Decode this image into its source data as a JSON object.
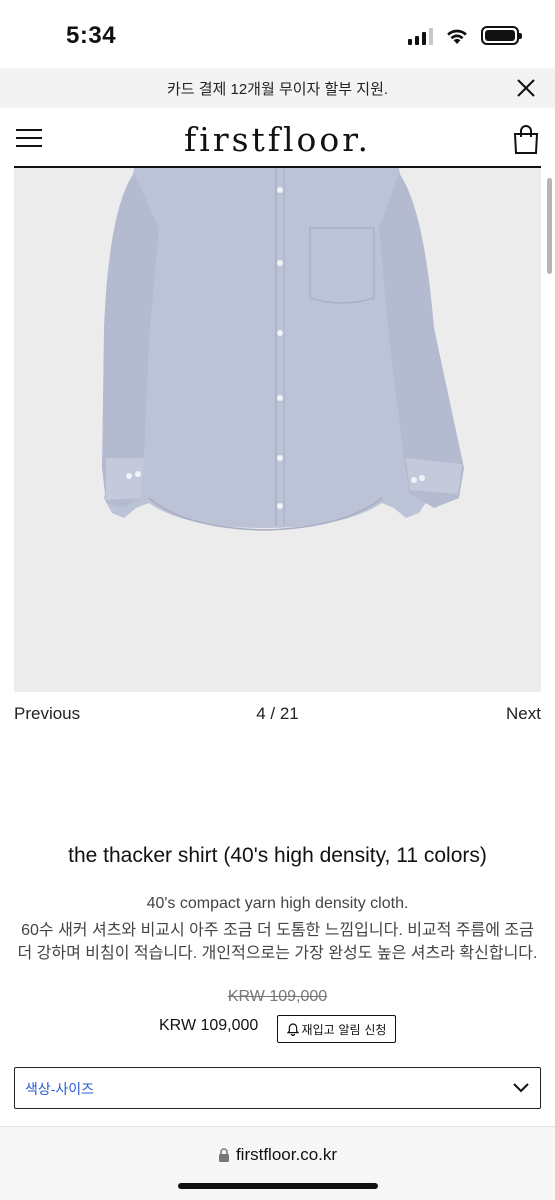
{
  "status_bar": {
    "time": "5:34",
    "icons": [
      "cellular-signal-icon",
      "wifi-icon",
      "battery-icon"
    ]
  },
  "promo": {
    "text": "카드 결제 12개월 무이자 할부 지원.",
    "close_icon": "close-icon"
  },
  "header": {
    "logo": "firstfloor.",
    "menu_icon": "hamburger-menu-icon",
    "cart_icon": "shopping-bag-icon"
  },
  "gallery": {
    "image": "light blue long-sleeve button-down shirt on light gray background",
    "prev_label": "Previous",
    "counter": "4 / 21",
    "next_label": "Next"
  },
  "product": {
    "title": "the thacker shirt (40's high density, 11 colors)",
    "description_en": "40's compact yarn high density cloth.",
    "description_ko": "60수 새커 셔츠와 비교시 아주 조금 더 도톰한 느낌입니다. 비교적 주름에 조금 더 강하며 비침이 적습니다. 개인적으로는 가장 완성도 높은 셔츠라 확신합니다.",
    "price_original": "KRW 109,000",
    "price_current": "KRW 109,000",
    "restock_label": "재입고 알림 신청"
  },
  "options": {
    "selected_label": "색상-사이즈"
  },
  "browser": {
    "url": "firstfloor.co.kr"
  },
  "colors": {
    "background": "#ffffff",
    "promo_bg": "#f3f3f3",
    "image_bg": "#ececec",
    "shirt": "#bcc3d6",
    "option_text": "#2a5bd7"
  }
}
